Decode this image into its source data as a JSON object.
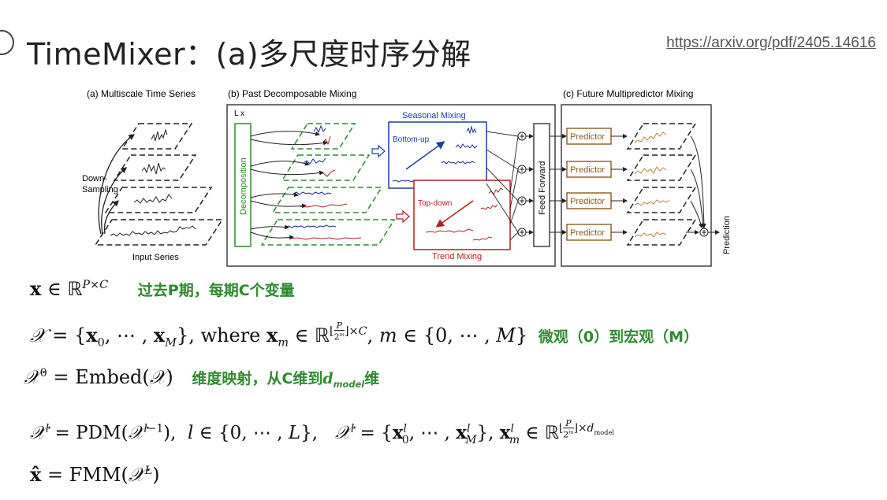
{
  "slide": {
    "title": "TimeMixer：(a)多尺度时序分解",
    "link": "https://arxiv.org/pdf/2405.14616"
  },
  "figure": {
    "panel_a_title": "(a) Multiscale Time Series",
    "panel_b_title": "(b) Past Decomposable Mixing",
    "panel_c_title": "(c) Future Multipredictor Mixing",
    "down_sampling": [
      "Down-",
      "Sampling"
    ],
    "input_series": "Input Series",
    "loop_label": "L x",
    "decomposition": "Decomposition",
    "seasonal_mixing": "Seasonal Mixing",
    "bottom_up": "Bottom-up",
    "top_down": "Top-down",
    "trend_mixing": "Trend Mixing",
    "feed_forward": "Feed Forward",
    "predictor": "Predictor",
    "prediction": "Prediction"
  },
  "equations": {
    "eq1_note": "过去P期，每期C个变量",
    "eq2_where": "where",
    "eq2_note": "微观（0）到宏观（M）",
    "eq3_embed": "Embed",
    "eq3_note": "维度映射，从C维到",
    "eq3_note_sub": "model",
    "eq3_note_tail": "维",
    "eq4_fn": "PDM",
    "eq5_fn": "FMM"
  },
  "colors": {
    "green": "#2e8b2e",
    "blue": "#1a2a8a",
    "red": "#a02020",
    "brown": "#8b5a1a"
  }
}
